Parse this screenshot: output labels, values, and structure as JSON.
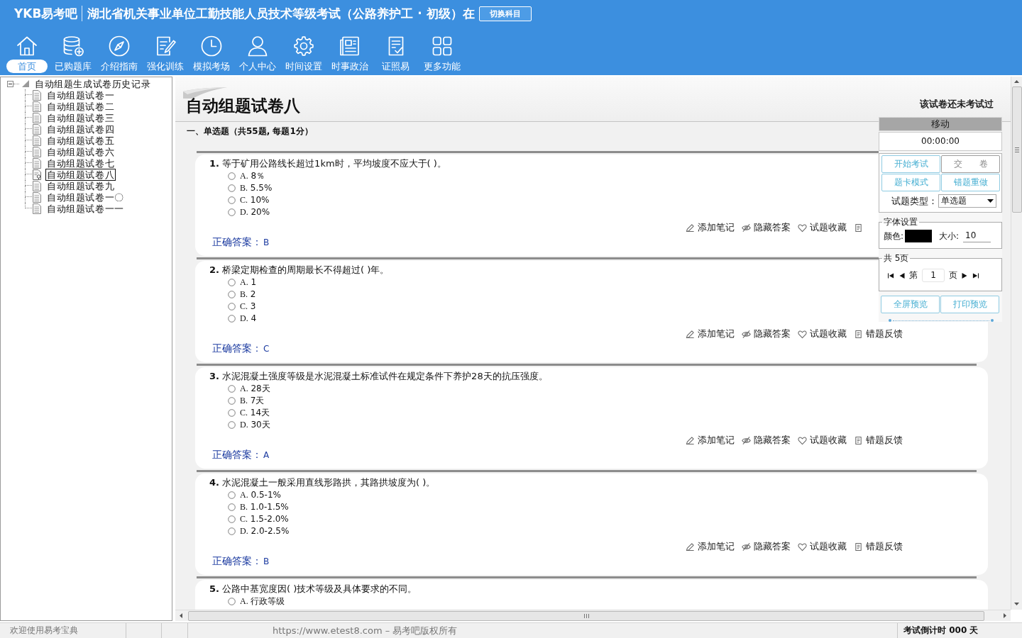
{
  "header": {
    "logo": "YKB易考吧",
    "title": "湖北省机关事业单位工勤技能人员技术等级考试（公路养护工 · 初级）在",
    "switch_button": "切换科目"
  },
  "toolbar": [
    {
      "kind": "home",
      "label": "首页",
      "selected": true
    },
    {
      "kind": "database",
      "label": "已购题库",
      "selected": false
    },
    {
      "kind": "compass",
      "label": "介绍指南",
      "selected": false
    },
    {
      "kind": "edit",
      "label": "强化训练",
      "selected": false
    },
    {
      "kind": "clock",
      "label": "模拟考场",
      "selected": false
    },
    {
      "kind": "person",
      "label": "个人中心",
      "selected": false
    },
    {
      "kind": "gear",
      "label": "时间设置",
      "selected": false
    },
    {
      "kind": "news",
      "label": "时事政治",
      "selected": false
    },
    {
      "kind": "checklist",
      "label": "证照易",
      "selected": false
    },
    {
      "kind": "grid",
      "label": "更多功能",
      "selected": false
    }
  ],
  "tree": {
    "label": "自动组题生成试卷历史记录",
    "expanded": true,
    "children": [
      {
        "label": "自动组题试卷一",
        "selected": false
      },
      {
        "label": "自动组题试卷二",
        "selected": false
      },
      {
        "label": "自动组题试卷三",
        "selected": false
      },
      {
        "label": "自动组题试卷四",
        "selected": false
      },
      {
        "label": "自动组题试卷五",
        "selected": false
      },
      {
        "label": "自动组题试卷六",
        "selected": false
      },
      {
        "label": "自动组题试卷七",
        "selected": false
      },
      {
        "label": "自动组题试卷八",
        "selected": true
      },
      {
        "label": "自动组题试卷九",
        "selected": false
      },
      {
        "label": "自动组题试卷一〇",
        "selected": false
      },
      {
        "label": "自动组题试卷一一",
        "selected": false
      }
    ]
  },
  "paper": {
    "title": "自动组题试卷八",
    "status": "该试卷还未考试过",
    "section": "一、单选题（共55题, 每题1分）"
  },
  "questions": [
    {
      "number": "1.",
      "text": "等于矿用公路线长超过1km时，平均坡度不应大于( )。",
      "options": [
        {
          "label": "A.",
          "text": "8％",
          "selected": false
        },
        {
          "label": "B.",
          "text": "5.5%",
          "selected": false
        },
        {
          "label": "C.",
          "text": "10%",
          "selected": false
        },
        {
          "label": "D.",
          "text": "20%",
          "selected": false
        }
      ],
      "actions": [
        {
          "kind": "note",
          "label": "添加笔记"
        },
        {
          "kind": "hide",
          "label": "隐藏答案"
        },
        {
          "kind": "favorite",
          "label": "试题收藏"
        },
        {
          "kind": "feedback"
        }
      ],
      "answer_label": "正确答案：",
      "answer": "B"
    },
    {
      "number": "2.",
      "text": "桥梁定期检查的周期最长不得超过( )年。",
      "options": [
        {
          "label": "A.",
          "text": "1",
          "selected": false
        },
        {
          "label": "B.",
          "text": "2",
          "selected": false
        },
        {
          "label": "C.",
          "text": "3",
          "selected": false
        },
        {
          "label": "D.",
          "text": "4",
          "selected": false
        }
      ],
      "actions": [
        {
          "kind": "note",
          "label": "添加笔记"
        },
        {
          "kind": "hide",
          "label": "隐藏答案"
        },
        {
          "kind": "favorite",
          "label": "试题收藏"
        },
        {
          "kind": "feedback",
          "label": "错题反馈"
        }
      ],
      "answer_label": "正确答案：",
      "answer": "C"
    },
    {
      "number": "3.",
      "text": "水泥混凝土强度等级是水泥混凝土标准试件在规定条件下养护28天的抗压强度。",
      "options": [
        {
          "label": "A.",
          "text": "28天",
          "selected": false
        },
        {
          "label": "B.",
          "text": "7天",
          "selected": false
        },
        {
          "label": "C.",
          "text": "14天",
          "selected": false
        },
        {
          "label": "D.",
          "text": "30天",
          "selected": false
        }
      ],
      "actions": [
        {
          "kind": "note",
          "label": "添加笔记"
        },
        {
          "kind": "hide",
          "label": "隐藏答案"
        },
        {
          "kind": "favorite",
          "label": "试题收藏"
        },
        {
          "kind": "feedback",
          "label": "错题反馈"
        }
      ],
      "answer_label": "正确答案：",
      "answer": "A"
    },
    {
      "number": "4.",
      "text": "水泥混凝土一般采用直线形路拱，其路拱坡度为( )。",
      "options": [
        {
          "label": "A.",
          "text": "0.5-1%",
          "selected": false
        },
        {
          "label": "B.",
          "text": "1.0-1.5%",
          "selected": false
        },
        {
          "label": "C.",
          "text": "1.5-2.0%",
          "selected": false
        },
        {
          "label": "D.",
          "text": "2.0-2.5%",
          "selected": false
        }
      ],
      "actions": [
        {
          "kind": "note",
          "label": "添加笔记"
        },
        {
          "kind": "hide",
          "label": "隐藏答案"
        },
        {
          "kind": "favorite",
          "label": "试题收藏"
        },
        {
          "kind": "feedback",
          "label": "错题反馈"
        }
      ],
      "answer_label": "正确答案：",
      "answer": "B"
    },
    {
      "number": "5.",
      "text": "公路中基宽度因( )技术等级及具体要求的不同。",
      "options": [
        {
          "label": "A.",
          "text": "行政等级",
          "selected": false
        }
      ]
    }
  ],
  "panel": {
    "header": "移动",
    "timer": "00:00:00",
    "buttons": [
      {
        "label": "开始考试",
        "disabled": false
      },
      {
        "label": "交　　卷",
        "disabled": true
      },
      {
        "label": "题卡模式",
        "disabled": false
      },
      {
        "label": "错题重做",
        "disabled": false
      }
    ],
    "type_label": "试题类型：",
    "type_value": "单选题",
    "font_legend": "字体设置",
    "color_label": "颜色:",
    "size_label": "大小:",
    "size_value": "10",
    "pager_legend": "共 5页",
    "page_prefix": "第",
    "page_value": "1",
    "page_suffix": "页",
    "preview_buttons": [
      "全屏预览",
      "打印预览"
    ]
  },
  "status_bar": {
    "welcome": "欢迎使用易考宝典",
    "copyright": "https://www.etest8.com – 易考吧版权所有",
    "countdown": "考试倒计时 000 天"
  }
}
